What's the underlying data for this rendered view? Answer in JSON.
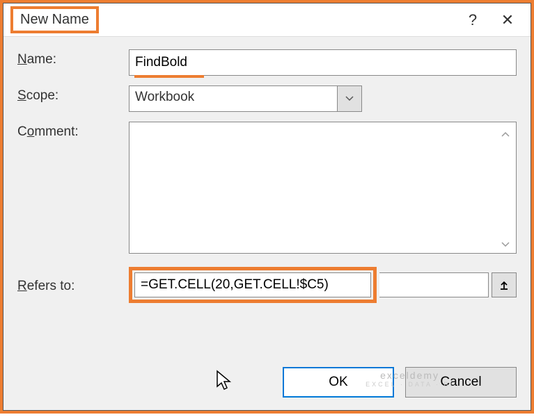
{
  "dialog": {
    "title": "New Name",
    "help_symbol": "?",
    "close_symbol": "✕"
  },
  "labels": {
    "name_prefix": "N",
    "name_suffix": "ame:",
    "scope_prefix": "S",
    "scope_suffix": "cope:",
    "comment_prefix": "C",
    "comment_middle": "o",
    "comment_suffix": "mment:",
    "refers_prefix": "R",
    "refers_suffix": "efers to:"
  },
  "fields": {
    "name_value": "FindBold",
    "scope_value": "Workbook",
    "comment_value": "",
    "refers_to_value": "=GET.CELL(20,GET.CELL!$C5)"
  },
  "buttons": {
    "ok": "OK",
    "cancel": "Cancel"
  },
  "watermark": {
    "main": "exceldemy",
    "sub": "EXCEL · DATA · BI"
  }
}
